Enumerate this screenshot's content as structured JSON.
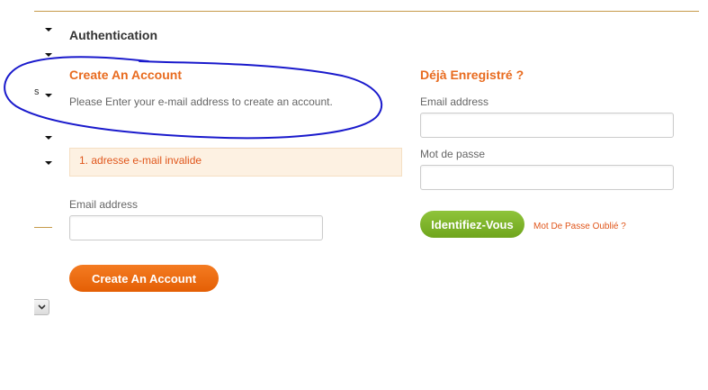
{
  "sidebar": {
    "fragment_text": "s"
  },
  "page": {
    "title": "Authentication"
  },
  "create_account": {
    "heading": "Create An Account",
    "intro": "Please Enter your e-mail address to create an account.",
    "error": "1. adresse e-mail invalide",
    "email_label": "Email address",
    "email_value": "",
    "submit_label": "Create An Account"
  },
  "login": {
    "heading": "Déjà Enregistré ?",
    "email_label": "Email address",
    "email_value": "",
    "password_label": "Mot de passe",
    "password_value": "",
    "submit_label": "Identifiez-Vous",
    "forgot_label": "Mot De Passe Oublié ?"
  },
  "colors": {
    "accent_orange": "#e86b1f",
    "accent_green": "#7bb32e",
    "annotation_blue": "#1a1acc",
    "rule_gold": "#c69a4a"
  },
  "icons": [
    "caret-down-icon",
    "chevron-down-icon"
  ]
}
